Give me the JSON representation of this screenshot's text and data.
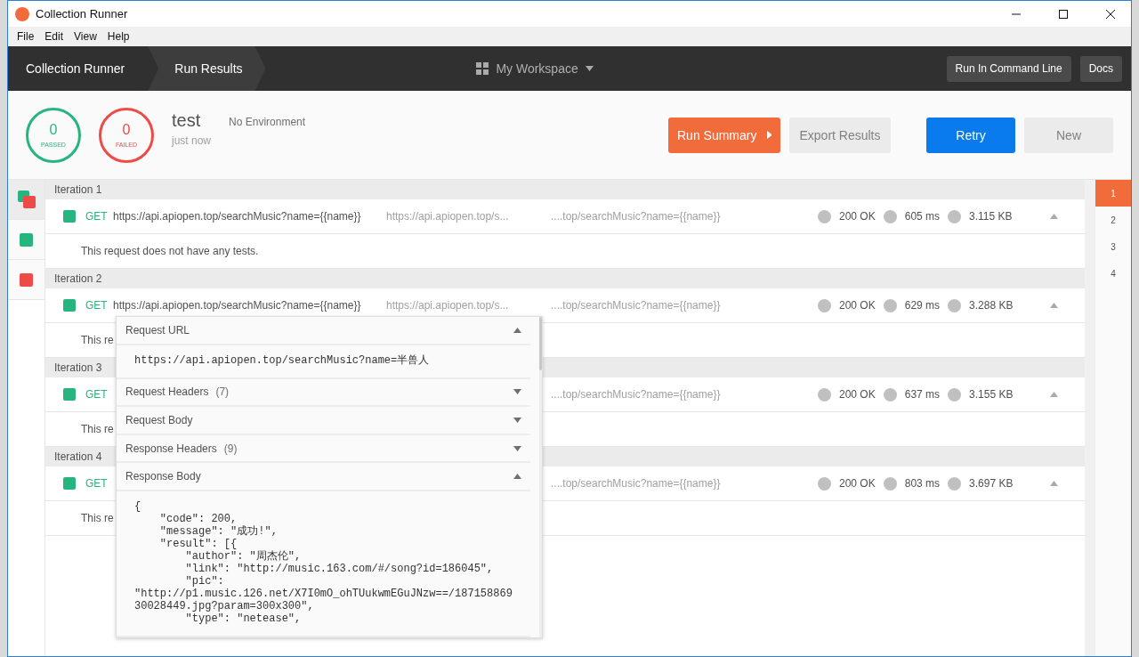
{
  "window": {
    "title": "Collection Runner"
  },
  "menu": [
    "File",
    "Edit",
    "View",
    "Help"
  ],
  "nav": {
    "crumbs": [
      {
        "label": "Collection Runner",
        "selected": false
      },
      {
        "label": "Run Results",
        "selected": true
      }
    ],
    "workspace": "My Workspace",
    "actions": [
      "Run In Command Line",
      "Docs"
    ]
  },
  "summary": {
    "passed": {
      "count": "0",
      "label": "PASSED"
    },
    "failed": {
      "count": "0",
      "label": "FAILED"
    },
    "name": "test",
    "environment": "No Environment",
    "time": "just now",
    "buttons": [
      {
        "label": "Run Summary",
        "kind": "orange"
      },
      {
        "label": "Export Results",
        "kind": "grey"
      },
      {
        "label": "Retry",
        "kind": "blue"
      },
      {
        "label": "New",
        "kind": "grey"
      }
    ]
  },
  "filters": [
    {
      "kind": "all",
      "selected": true
    },
    {
      "kind": "passed",
      "selected": false
    },
    {
      "kind": "failed",
      "selected": false
    }
  ],
  "iterations": [
    {
      "label": "Iteration 1",
      "method": "GET",
      "url": "https://api.apiopen.top/searchMusic?name={{name}}",
      "url_2": "https://api.apiopen.top/s...",
      "url_3": "....top/searchMusic?name={{name}}",
      "status": "200 OK",
      "time": "605 ms",
      "size": "3.115 KB",
      "expanded": true,
      "note": "This request does not have any tests."
    },
    {
      "label": "Iteration 2",
      "method": "GET",
      "url": "https://api.apiopen.top/searchMusic?name={{name}}",
      "url_2": "https://api.apiopen.top/s...",
      "url_3": "....top/searchMusic?name={{name}}",
      "status": "200 OK",
      "time": "629 ms",
      "size": "3.288 KB",
      "expanded": true,
      "note": "This re"
    },
    {
      "label": "Iteration 3",
      "method": "GET",
      "url_3": "....top/searchMusic?name={{name}}",
      "status": "200 OK",
      "time": "637 ms",
      "size": "3.155 KB",
      "expanded": true,
      "note": "This re"
    },
    {
      "label": "Iteration 4",
      "method": "GET",
      "url_3": "....top/searchMusic?name={{name}}",
      "status": "200 OK",
      "time": "803 ms",
      "size": "3.697 KB",
      "expanded": true,
      "note": "This re"
    }
  ],
  "iteration_nav": [
    {
      "label": "1",
      "selected": true
    },
    {
      "label": "2",
      "selected": false
    },
    {
      "label": "3",
      "selected": false
    },
    {
      "label": "4",
      "selected": false
    }
  ],
  "popover": {
    "sections": [
      {
        "title": "Request URL",
        "expanded": true,
        "content": "https://api.apiopen.top/searchMusic?name=半兽人"
      },
      {
        "title": "Request Headers",
        "count": "(7)",
        "expanded": false
      },
      {
        "title": "Request Body",
        "expanded": false
      },
      {
        "title": "Response Headers",
        "count": "(9)",
        "expanded": false
      },
      {
        "title": "Response Body",
        "expanded": true,
        "content": "{\n    \"code\": 200,\n    \"message\": \"成功!\",\n    \"result\": [{\n        \"author\": \"周杰伦\",\n        \"link\": \"http://music.163.com/#/song?id=186045\",\n        \"pic\":\n\"http://p1.music.126.net/X7I0mO_ohTUukwmEGuJNzw==/187158869\n30028449.jpg?param=300x300\",\n        \"type\": \"netease\","
      }
    ]
  }
}
